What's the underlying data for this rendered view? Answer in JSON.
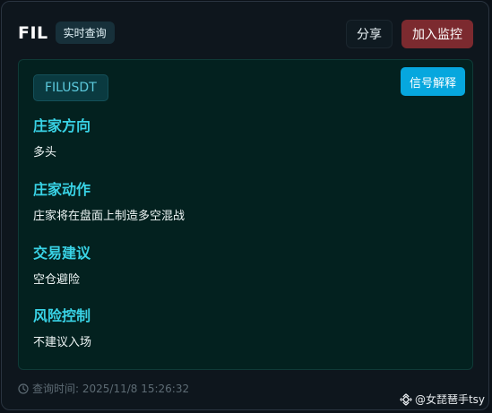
{
  "header": {
    "symbol": "FIL",
    "badge": "实时查询",
    "share_label": "分享",
    "monitor_label": "加入监控"
  },
  "panel": {
    "pair": "FILUSDT",
    "signal_label": "信号解释",
    "sections": [
      {
        "title": "庄家方向",
        "value": "多头"
      },
      {
        "title": "庄家动作",
        "value": "庄家将在盘面上制造多空混战"
      },
      {
        "title": "交易建议",
        "value": "空仓避险"
      },
      {
        "title": "风险控制",
        "value": "不建议入场"
      }
    ]
  },
  "footer": {
    "query_time": "查询时间: 2025/11/8 15:26:32",
    "watermark": "@女琵琶手tsy"
  },
  "colors": {
    "accent": "#39d3e6",
    "monitor_button": "#7c2a2f",
    "signal_button": "#06a7de"
  },
  "icons": {
    "time": "clock-icon",
    "watermark": "binance-logo-icon"
  }
}
